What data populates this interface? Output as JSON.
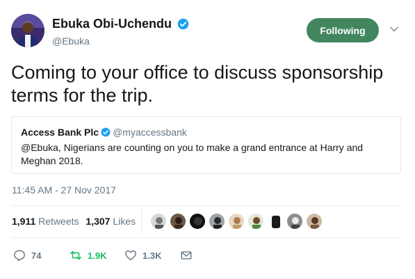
{
  "author": {
    "display_name": "Ebuka Obi-Uchendu",
    "handle": "@Ebuka",
    "verified": true
  },
  "follow_button": {
    "label": "Following",
    "color": "#41865e"
  },
  "tweet": {
    "text": "Coming to your office to discuss sponsorship terms for the trip."
  },
  "quoted": {
    "display_name": "Access Bank Plc",
    "handle": "@myaccessbank",
    "verified": true,
    "text": "@Ebuka, Nigerians are counting on you to make a grand entrance at Harry and Meghan 2018."
  },
  "timestamp": "11:45 AM - 27 Nov 2017",
  "stats": {
    "retweets_count": "1,911",
    "retweets_label": "Retweets",
    "likes_count": "1,307",
    "likes_label": "Likes"
  },
  "actions": {
    "reply_count": "74",
    "retweet_count": "1.9K",
    "like_count": "1.3K"
  },
  "colors": {
    "verified_blue": "#1da1f2",
    "retweet_green": "#17bf63",
    "secondary_text": "#657786"
  },
  "icons": [
    "verified-badge-icon",
    "caret-down-icon",
    "reply-icon",
    "retweet-icon",
    "like-icon",
    "direct-message-icon"
  ]
}
